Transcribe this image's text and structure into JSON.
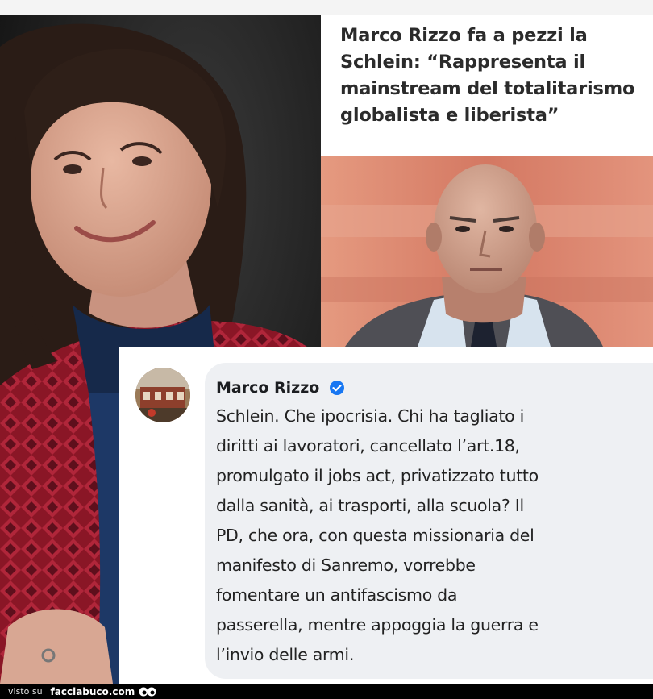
{
  "headline": {
    "text": "Marco Rizzo fa a pezzi la Schlein: “Rappresenta il mainstream del totalitarismo globalista e liberista”"
  },
  "comment": {
    "author": "Marco Rizzo",
    "text": "Schlein. Che  ipocrisia. Chi ha tagliato i\ndiritti ai lavoratori, cancellato l’art.18,\npromulgato il jobs act, privatizzato tutto\ndalla sanità, ai trasporti, alla scuola? Il\nPD, che ora, con questa missionaria del\nmanifesto di Sanremo, vorrebbe\nfomentare un antifascismo da\npasserella, mentre appoggia la guerra e\nl’invio delle armi."
  },
  "footer": {
    "prefix": "visto su",
    "site": "facciabuco.com"
  },
  "icons": {
    "verified": "verified-badge-icon",
    "logo": "facciabuco-logo-icon"
  },
  "colors": {
    "verified_blue": "#1877f2",
    "bubble_bg": "#eef0f3",
    "footer_bg": "#000000"
  }
}
